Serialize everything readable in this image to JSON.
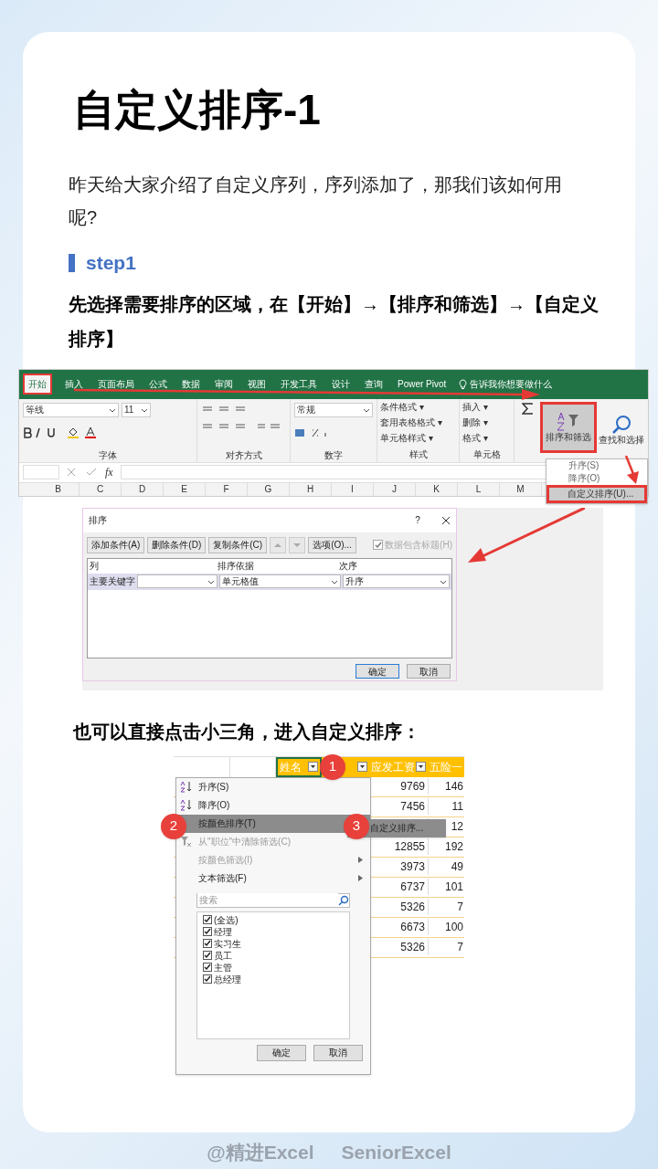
{
  "title": "自定义排序-1",
  "intro": "昨天给大家介绍了自定义序列，序列添加了，那我们该如何用呢?",
  "step": {
    "label": "step1",
    "instruction": "先选择需要排序的区域，在【开始】→【排序和筛选】→【自定义排序】"
  },
  "ribbon": {
    "tabs": [
      {
        "label": "开始",
        "selected": true
      },
      {
        "label": "插入",
        "selected": false
      },
      {
        "label": "页面布局",
        "selected": false
      },
      {
        "label": "公式",
        "selected": false
      },
      {
        "label": "数据",
        "selected": false
      },
      {
        "label": "审阅",
        "selected": false
      },
      {
        "label": "视图",
        "selected": false
      },
      {
        "label": "开发工具",
        "selected": false
      },
      {
        "label": "设计",
        "selected": false
      },
      {
        "label": "查询",
        "selected": false
      },
      {
        "label": "Power Pivot",
        "selected": false
      }
    ],
    "tell_me": "告诉我你想要做什么",
    "font_name": "等线",
    "font_size": "11",
    "number_format": "常规",
    "style_items": [
      "条件格式 ▾",
      "套用表格格式 ▾",
      "单元格样式 ▾"
    ],
    "cell_items": [
      "插入 ▾",
      "删除 ▾",
      "格式 ▾"
    ],
    "sort_button": "排序和筛选",
    "find_button": "查找和选择",
    "groups": [
      "字体",
      "对齐方式",
      "数字",
      "样式",
      "单元格"
    ],
    "fx": "fx",
    "column_letters": [
      "B",
      "C",
      "D",
      "E",
      "F",
      "G",
      "H",
      "I",
      "J",
      "K",
      "L",
      "M"
    ],
    "sort_menu": [
      {
        "label": "升序(S)",
        "selected": false
      },
      {
        "label": "降序(O)",
        "selected": false
      },
      {
        "label": "自定义排序(U)...",
        "selected": true
      }
    ]
  },
  "dialog": {
    "title": "排序",
    "help": "?",
    "toolbar": [
      "添加条件(A)",
      "删除条件(D)",
      "复制条件(C)",
      "选项(O)..."
    ],
    "has_headers": {
      "label": "数据包含标题(H)",
      "checked": true,
      "disabled": true
    },
    "columns": [
      "列",
      "排序依据",
      "次序"
    ],
    "row": {
      "label": "主要关键字",
      "basis": "单元格值",
      "order": "升序"
    },
    "buttons": [
      "确定",
      "取消"
    ]
  },
  "note": "也可以直接点击小三角，进入自定义排序：",
  "filter": {
    "headers": [
      "姓名",
      "应发工资",
      "五险一"
    ],
    "menu": [
      {
        "label": "升序(S)",
        "kind": "sort",
        "disabled": false,
        "selected": false
      },
      {
        "label": "降序(O)",
        "kind": "sort",
        "disabled": false,
        "selected": false
      },
      {
        "label": "按颜色排序(T)",
        "kind": "submenu",
        "disabled": false,
        "selected": true
      },
      {
        "label": "从\"职位\"中清除筛选(C)",
        "kind": "clear",
        "disabled": true,
        "selected": false
      },
      {
        "label": "按颜色筛选(I)",
        "kind": "submenu",
        "disabled": true,
        "selected": false
      },
      {
        "label": "文本筛选(F)",
        "kind": "submenu",
        "disabled": false,
        "selected": false
      }
    ],
    "submenu": "自定义排序...",
    "search": {
      "placeholder": "搜索"
    },
    "options": [
      {
        "label": "(全选)",
        "checked": true
      },
      {
        "label": "经理",
        "checked": true
      },
      {
        "label": "实习生",
        "checked": true
      },
      {
        "label": "员工",
        "checked": true
      },
      {
        "label": "主管",
        "checked": true
      },
      {
        "label": "总经理",
        "checked": true
      }
    ],
    "buttons": [
      "确定",
      "取消"
    ],
    "rows": [
      {
        "wage": "9769",
        "insurance": "146"
      },
      {
        "wage": "7456",
        "insurance": "11"
      },
      {
        "insurance": "12"
      },
      {
        "wage": "12855",
        "insurance": "192"
      },
      {
        "wage": "3973",
        "insurance": "49"
      },
      {
        "wage": "6737",
        "insurance": "101"
      },
      {
        "wage": "5326",
        "insurance": "7"
      },
      {
        "wage": "6673",
        "insurance": "100"
      },
      {
        "wage": "5326",
        "insurance": "7"
      }
    ],
    "callouts": [
      "1",
      "2",
      "3"
    ]
  },
  "footer": [
    "@精进Excel",
    "SeniorExcel"
  ]
}
